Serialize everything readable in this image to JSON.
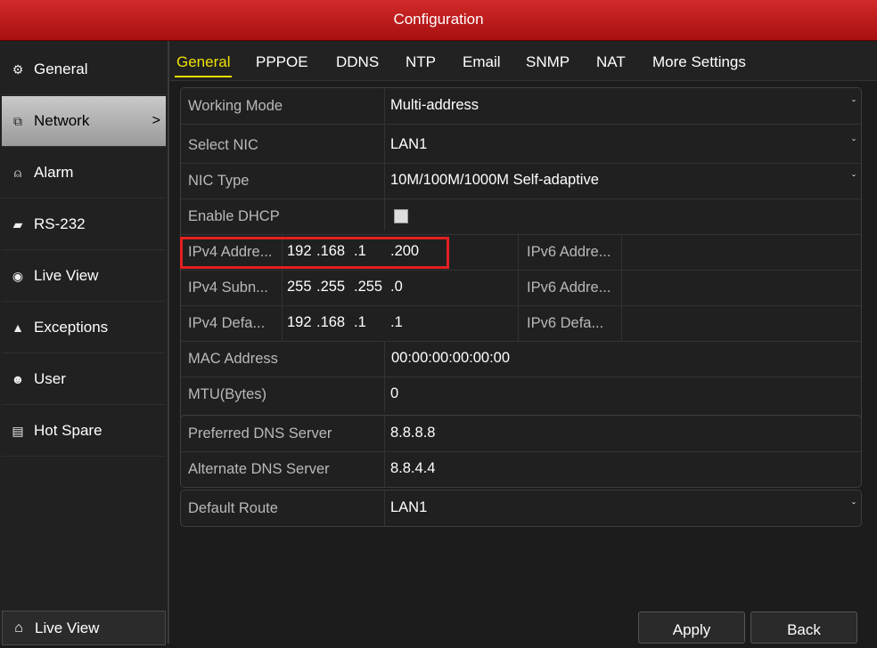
{
  "window": {
    "title": "Configuration"
  },
  "sidebar": {
    "items": [
      {
        "label": "General",
        "icon": "gear-icon"
      },
      {
        "label": "Network",
        "icon": "network-icon",
        "active": true
      },
      {
        "label": "Alarm",
        "icon": "alarm-icon"
      },
      {
        "label": "RS-232",
        "icon": "serial-port-icon"
      },
      {
        "label": "Live View",
        "icon": "eye-icon"
      },
      {
        "label": "Exceptions",
        "icon": "warning-icon"
      },
      {
        "label": "User",
        "icon": "users-icon"
      },
      {
        "label": "Hot Spare",
        "icon": "hot-spare-icon"
      }
    ],
    "active_chevron": ">",
    "bottom": {
      "label": "Live View",
      "icon": "home-icon"
    }
  },
  "tabs": [
    "General",
    "PPPOE",
    "DDNS",
    "NTP",
    "Email",
    "SNMP",
    "NAT",
    "More Settings"
  ],
  "form": {
    "working_mode": {
      "label": "Working Mode",
      "value": "Multi-address"
    },
    "select_nic": {
      "label": "Select NIC",
      "value": "LAN1"
    },
    "nic_type": {
      "label": "NIC Type",
      "value": "10M/100M/1000M Self-adaptive"
    },
    "enable_dhcp": {
      "label": "Enable DHCP",
      "checked": false
    },
    "ipv4_address": {
      "label": "IPv4 Addre...",
      "octets": [
        "192",
        ".168",
        ".1",
        ".200"
      ]
    },
    "ipv4_subnet": {
      "label": "IPv4 Subn...",
      "octets": [
        "255",
        ".255",
        ".255",
        ".0"
      ]
    },
    "ipv4_gateway": {
      "label": "IPv4 Defa...",
      "octets": [
        "192",
        ".168",
        ".1",
        ".1"
      ]
    },
    "ipv6_address_1": {
      "label": "IPv6 Addre...",
      "value": ""
    },
    "ipv6_address_2": {
      "label": "IPv6 Addre...",
      "value": ""
    },
    "ipv6_gateway": {
      "label": "IPv6 Defa...",
      "value": ""
    },
    "mac_address": {
      "label": "MAC Address",
      "value": "00:00:00:00:00:00"
    },
    "mtu": {
      "label": "MTU(Bytes)",
      "value": "0"
    },
    "preferred_dns": {
      "label": "Preferred DNS Server",
      "value": "8.8.8.8"
    },
    "alternate_dns": {
      "label": "Alternate DNS Server",
      "value": "8.8.4.4"
    },
    "default_route": {
      "label": "Default Route",
      "value": "LAN1"
    }
  },
  "dropdown_caret": "ˇ",
  "buttons": {
    "apply": "Apply",
    "back": "Back"
  },
  "colors": {
    "titlebar": "#c41a1a",
    "active_tab": "#f0e000",
    "highlight": "#e32020"
  }
}
